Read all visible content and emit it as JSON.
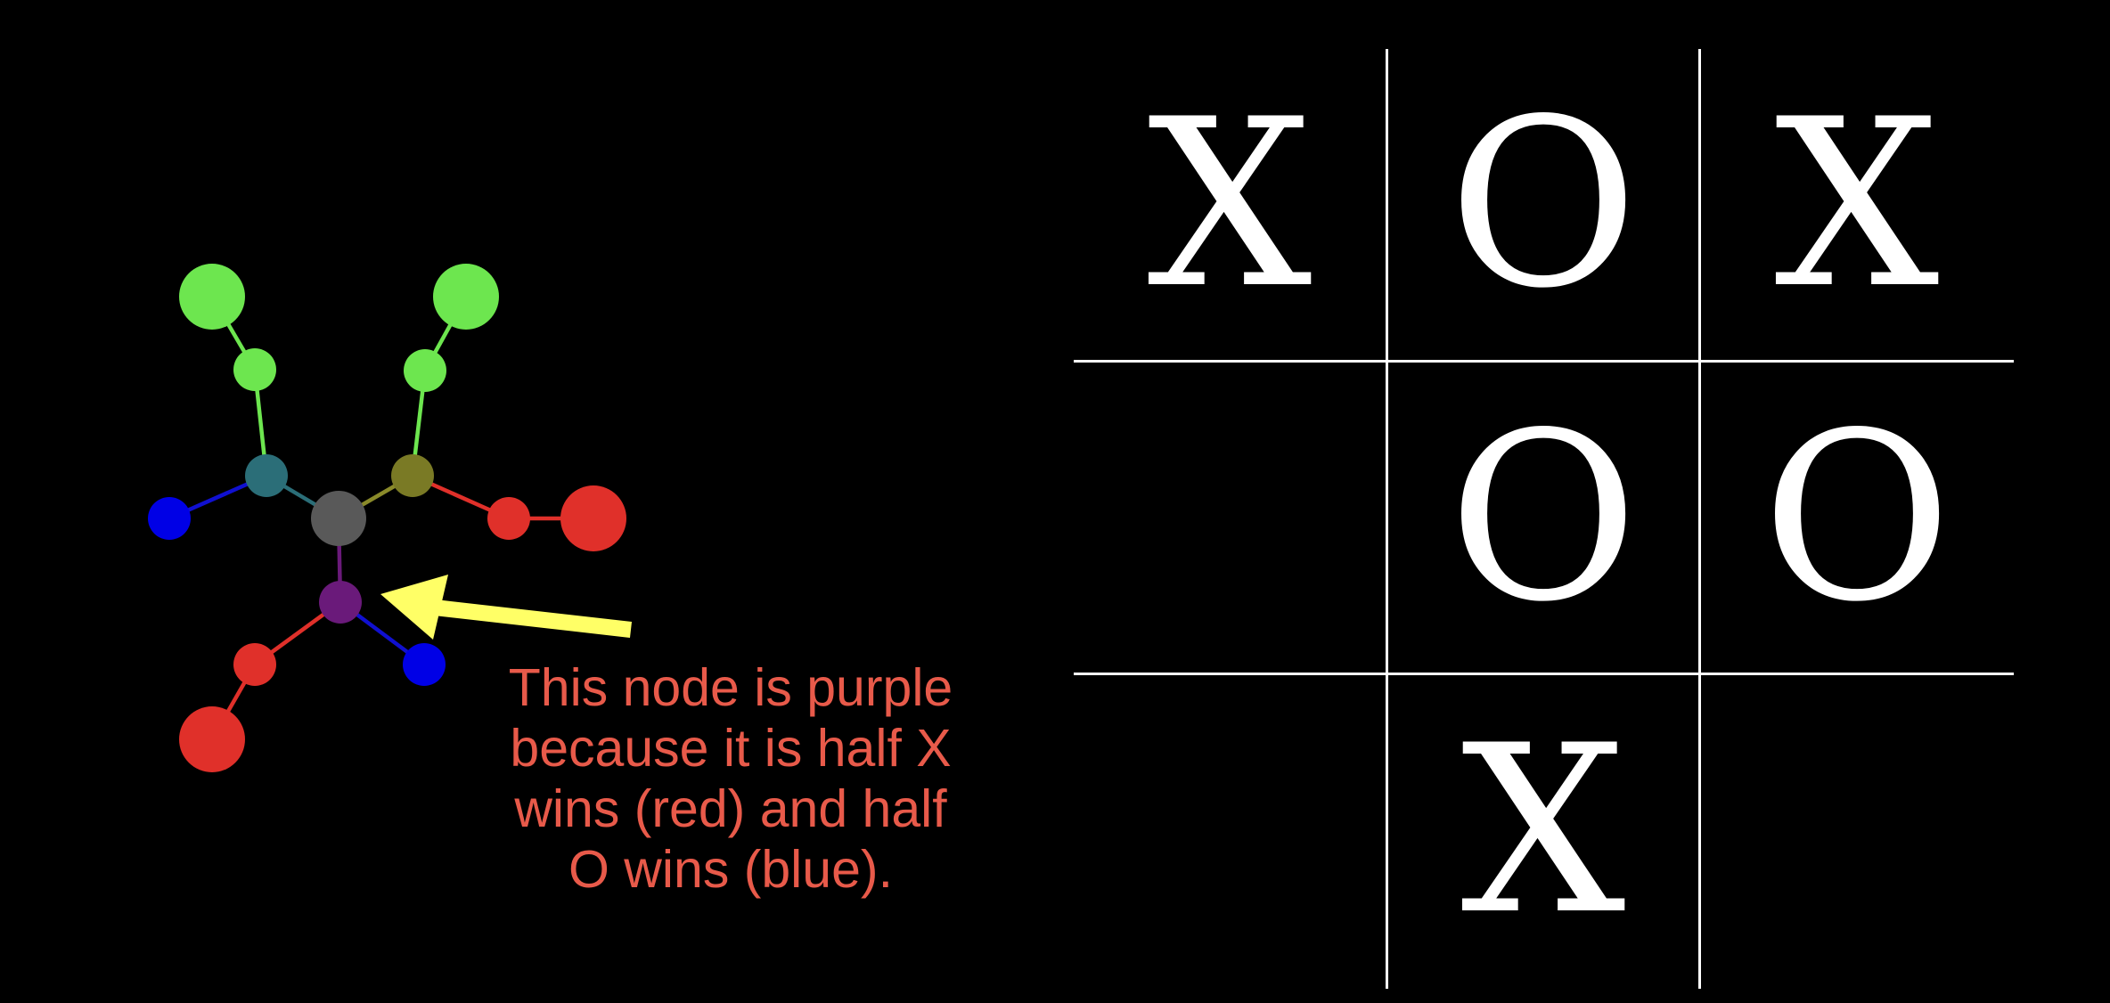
{
  "game_tree": {
    "edges": [
      {
        "from": "center",
        "to": "teal",
        "color": "#2b6e78"
      },
      {
        "from": "center",
        "to": "olive",
        "color": "#8a8a2a"
      },
      {
        "from": "center",
        "to": "purple",
        "color": "#6a1a7a"
      },
      {
        "from": "teal",
        "to": "g_left_mid",
        "color": "#6de64f"
      },
      {
        "from": "g_left_mid",
        "to": "g_left_big",
        "color": "#6de64f"
      },
      {
        "from": "teal",
        "to": "blue_left",
        "color": "#1010d0"
      },
      {
        "from": "olive",
        "to": "g_right_mid",
        "color": "#6de64f"
      },
      {
        "from": "g_right_mid",
        "to": "g_right_big",
        "color": "#6de64f"
      },
      {
        "from": "olive",
        "to": "red_right_mid",
        "color": "#e0302a"
      },
      {
        "from": "red_right_mid",
        "to": "red_right_big",
        "color": "#e0302a"
      },
      {
        "from": "purple",
        "to": "red_bottom_mid",
        "color": "#e0302a"
      },
      {
        "from": "red_bottom_mid",
        "to": "red_bottom_big",
        "color": "#e0302a"
      },
      {
        "from": "purple",
        "to": "blue_bottom",
        "color": "#1010d0"
      }
    ],
    "nodes": [
      {
        "id": "center",
        "color": "#595959"
      },
      {
        "id": "teal",
        "color": "#2b6e78"
      },
      {
        "id": "olive",
        "color": "#7a7a25"
      },
      {
        "id": "purple",
        "color": "#6a1a7a"
      },
      {
        "id": "g_left_mid",
        "color": "#6de64f"
      },
      {
        "id": "g_left_big",
        "color": "#6de64f"
      },
      {
        "id": "g_right_mid",
        "color": "#6de64f"
      },
      {
        "id": "g_right_big",
        "color": "#6de64f"
      },
      {
        "id": "blue_left",
        "color": "#0000e6"
      },
      {
        "id": "blue_bottom",
        "color": "#0000e6"
      },
      {
        "id": "red_right_mid",
        "color": "#e0302a"
      },
      {
        "id": "red_right_big",
        "color": "#e0302a"
      },
      {
        "id": "red_bottom_mid",
        "color": "#e0302a"
      },
      {
        "id": "red_bottom_big",
        "color": "#e0302a"
      }
    ],
    "arrow_color": "#ffff66"
  },
  "caption": {
    "line1": "This node is purple",
    "line2": "because it is half X",
    "line3": "wins (red) and half",
    "line4": "O wins (blue).",
    "color": "#e85a4a"
  },
  "board": {
    "cells": [
      "X",
      "O",
      "X",
      "",
      "O",
      "O",
      "",
      "X",
      ""
    ],
    "line_color": "#ffffff"
  }
}
